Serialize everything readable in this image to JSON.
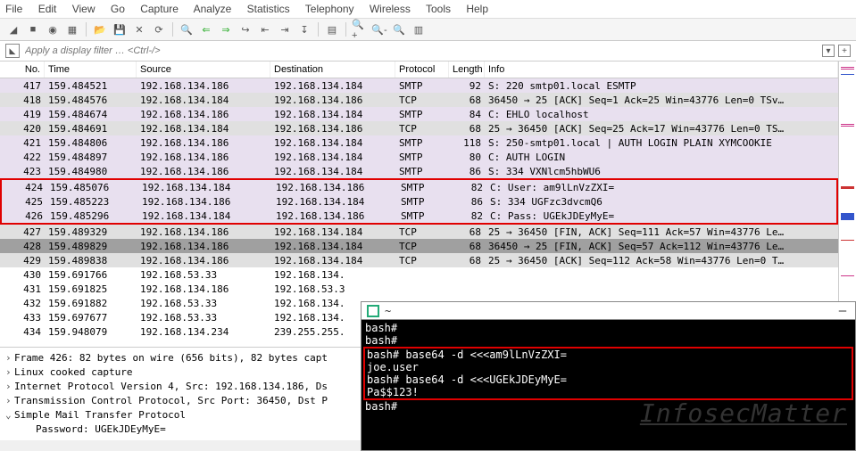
{
  "menu": [
    "File",
    "Edit",
    "View",
    "Go",
    "Capture",
    "Analyze",
    "Statistics",
    "Telephony",
    "Wireless",
    "Tools",
    "Help"
  ],
  "filter_placeholder": "Apply a display filter … <Ctrl-/>",
  "columns": [
    "No.",
    "Time",
    "Source",
    "Destination",
    "Protocol",
    "Length",
    "Info"
  ],
  "packets": [
    {
      "no": "417",
      "time": "159.484521",
      "src": "192.168.134.186",
      "dst": "192.168.134.184",
      "proto": "SMTP",
      "len": "92",
      "info": "S: 220 smtp01.local ESMTP",
      "cls": "purple"
    },
    {
      "no": "418",
      "time": "159.484576",
      "src": "192.168.134.184",
      "dst": "192.168.134.186",
      "proto": "TCP",
      "len": "68",
      "info": "36450 → 25 [ACK] Seq=1 Ack=25 Win=43776 Len=0 TSv…",
      "cls": "grey"
    },
    {
      "no": "419",
      "time": "159.484674",
      "src": "192.168.134.186",
      "dst": "192.168.134.184",
      "proto": "SMTP",
      "len": "84",
      "info": "C: EHLO localhost",
      "cls": "purple"
    },
    {
      "no": "420",
      "time": "159.484691",
      "src": "192.168.134.184",
      "dst": "192.168.134.186",
      "proto": "TCP",
      "len": "68",
      "info": "25 → 36450 [ACK] Seq=25 Ack=17 Win=43776 Len=0 TS…",
      "cls": "grey"
    },
    {
      "no": "421",
      "time": "159.484806",
      "src": "192.168.134.186",
      "dst": "192.168.134.184",
      "proto": "SMTP",
      "len": "118",
      "info": "S: 250-smtp01.local | AUTH LOGIN PLAIN XYMCOOKIE",
      "cls": "purple"
    },
    {
      "no": "422",
      "time": "159.484897",
      "src": "192.168.134.186",
      "dst": "192.168.134.184",
      "proto": "SMTP",
      "len": "80",
      "info": "C: AUTH LOGIN",
      "cls": "purple"
    },
    {
      "no": "423",
      "time": "159.484980",
      "src": "192.168.134.186",
      "dst": "192.168.134.184",
      "proto": "SMTP",
      "len": "86",
      "info": "S: 334 VXNlcm5hbWU6",
      "cls": "purple"
    },
    {
      "no": "424",
      "time": "159.485076",
      "src": "192.168.134.184",
      "dst": "192.168.134.186",
      "proto": "SMTP",
      "len": "82",
      "info": "C: User: am9lLnVzZXI=",
      "cls": "purple",
      "hl": true
    },
    {
      "no": "425",
      "time": "159.485223",
      "src": "192.168.134.186",
      "dst": "192.168.134.184",
      "proto": "SMTP",
      "len": "86",
      "info": "S: 334 UGFzc3dvcmQ6",
      "cls": "purple",
      "hl": true
    },
    {
      "no": "426",
      "time": "159.485296",
      "src": "192.168.134.184",
      "dst": "192.168.134.186",
      "proto": "SMTP",
      "len": "82",
      "info": "C: Pass: UGEkJDEyMyE=",
      "cls": "purple",
      "hl": true
    },
    {
      "no": "427",
      "time": "159.489329",
      "src": "192.168.134.186",
      "dst": "192.168.134.184",
      "proto": "TCP",
      "len": "68",
      "info": "25 → 36450 [FIN, ACK] Seq=111 Ack=57 Win=43776 Le…",
      "cls": "grey"
    },
    {
      "no": "428",
      "time": "159.489829",
      "src": "192.168.134.186",
      "dst": "192.168.134.184",
      "proto": "TCP",
      "len": "68",
      "info": "36450 → 25 [FIN, ACK] Seq=57 Ack=112 Win=43776 Le…",
      "cls": "darkgrey"
    },
    {
      "no": "429",
      "time": "159.489838",
      "src": "192.168.134.186",
      "dst": "192.168.134.184",
      "proto": "TCP",
      "len": "68",
      "info": "25 → 36450 [ACK] Seq=112 Ack=58 Win=43776 Len=0 T…",
      "cls": "grey"
    },
    {
      "no": "430",
      "time": "159.691766",
      "src": "192.168.53.33",
      "dst": "192.168.134.",
      "proto": "",
      "len": "",
      "info": "",
      "cls": "white"
    },
    {
      "no": "431",
      "time": "159.691825",
      "src": "192.168.134.186",
      "dst": "192.168.53.3",
      "proto": "",
      "len": "",
      "info": "",
      "cls": "white"
    },
    {
      "no": "432",
      "time": "159.691882",
      "src": "192.168.53.33",
      "dst": "192.168.134.",
      "proto": "",
      "len": "",
      "info": "",
      "cls": "white"
    },
    {
      "no": "433",
      "time": "159.697677",
      "src": "192.168.53.33",
      "dst": "192.168.134.",
      "proto": "",
      "len": "",
      "info": "",
      "cls": "white"
    },
    {
      "no": "434",
      "time": "159.948079",
      "src": "192.168.134.234",
      "dst": "239.255.255.",
      "proto": "",
      "len": "",
      "info": "",
      "cls": "white"
    }
  ],
  "details": {
    "l1": "Frame 426: 82 bytes on wire (656 bits), 82 bytes capt",
    "l2": "Linux cooked capture",
    "l3": "Internet Protocol Version 4, Src: 192.168.134.186, Ds",
    "l4": "Transmission Control Protocol, Src Port: 36450, Dst P",
    "l5": "Simple Mail Transfer Protocol",
    "l6": "Password: UGEkJDEyMyE="
  },
  "terminal": {
    "title": "~",
    "lines": {
      "p1": "bash#",
      "p2": "bash#",
      "c1": "bash# base64 -d <<<am9lLnVzZXI=",
      "o1": "joe.user",
      "c2": "bash# base64 -d <<<UGEkJDEyMyE=",
      "o2": "Pa$$123!",
      "p3": "bash#"
    }
  },
  "watermark": "InfosecMatter"
}
